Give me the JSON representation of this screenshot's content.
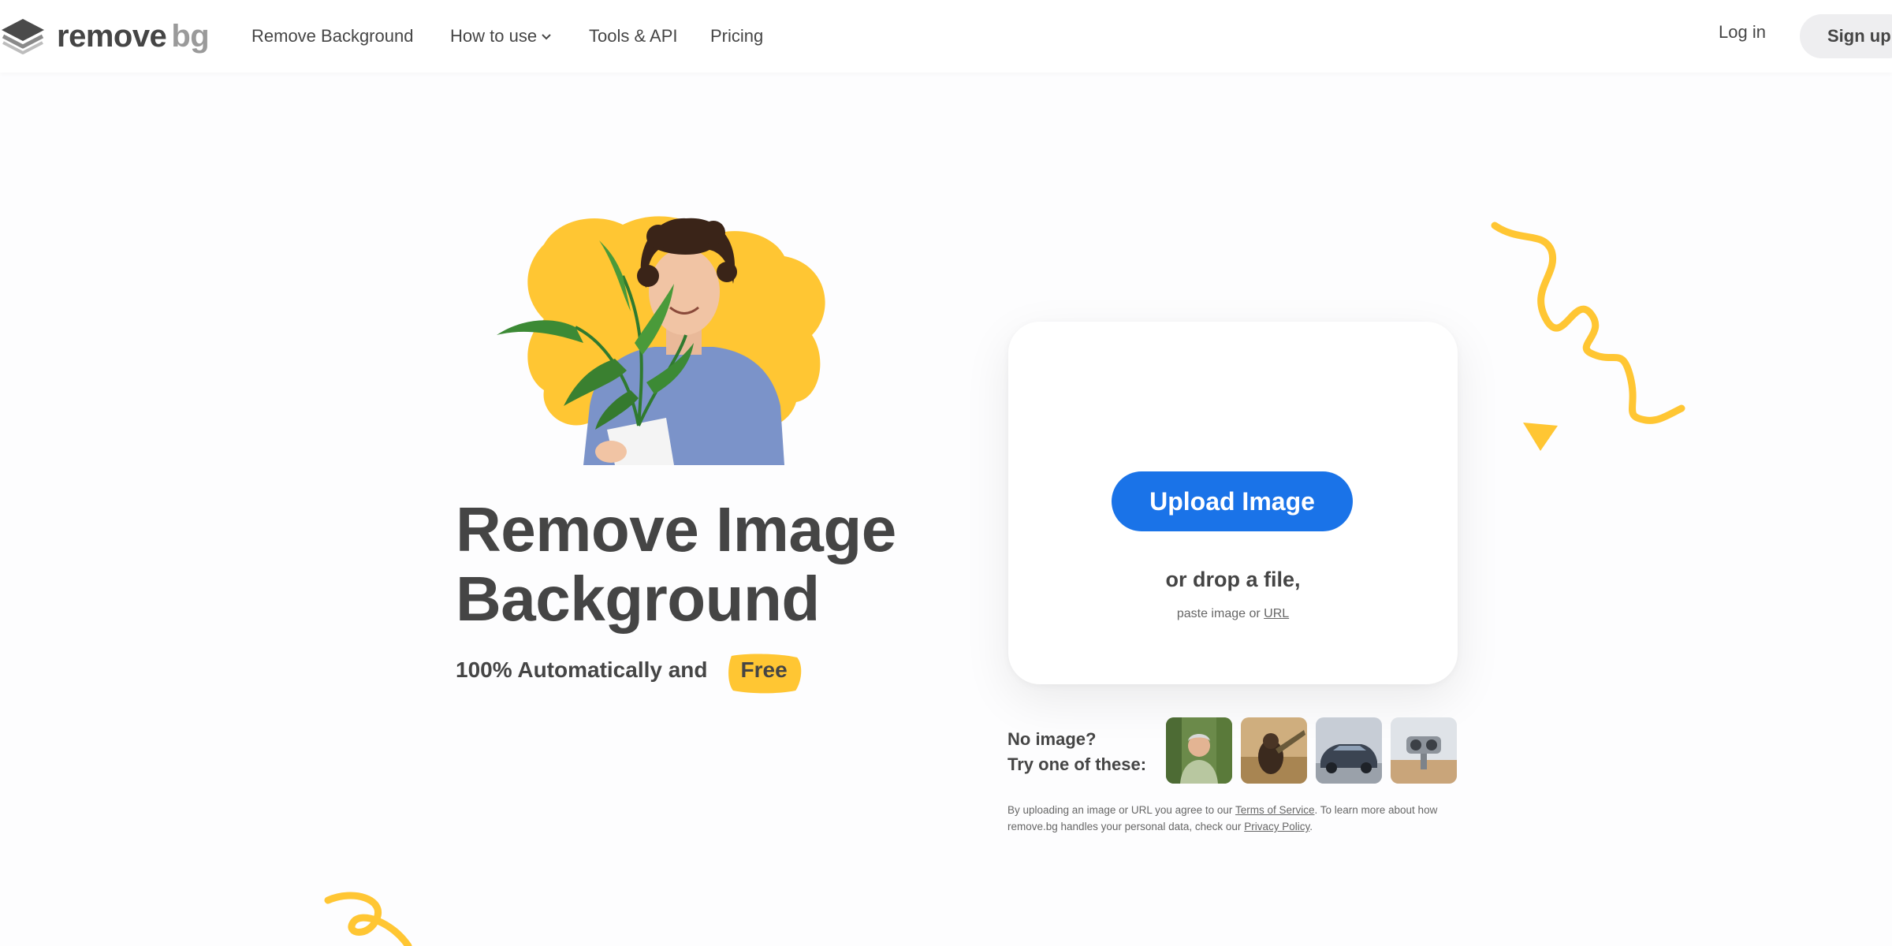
{
  "header": {
    "logo": {
      "word1": "remove",
      "word2": "bg"
    },
    "nav": [
      {
        "label": "Remove Background"
      },
      {
        "label": "How to use"
      },
      {
        "label": "Tools & API"
      },
      {
        "label": "Pricing"
      }
    ],
    "login_label": "Log in",
    "signup_label": "Sign up"
  },
  "hero": {
    "headline_line1": "Remove Image",
    "headline_line2": "Background",
    "subtitle": "100% Automatically and",
    "free_badge": "Free"
  },
  "upload": {
    "button_label": "Upload Image",
    "drop_text": "or drop a file,",
    "paste_text": "paste image or",
    "url_link": "URL"
  },
  "samples": {
    "line1": "No image?",
    "line2": "Try one of these:",
    "items": [
      "person-sample",
      "animal-sample",
      "car-sample",
      "product-sample"
    ]
  },
  "terms": {
    "part1": "By uploading an image or URL you agree to our",
    "tos_link": "Terms of Service",
    "part2": ". To learn more about how remove.bg handles your personal data, check our",
    "privacy_link": "Privacy Policy",
    "part3": "."
  },
  "colors": {
    "accent": "#1a73e8",
    "yellow": "#ffc633",
    "text": "#454545"
  }
}
